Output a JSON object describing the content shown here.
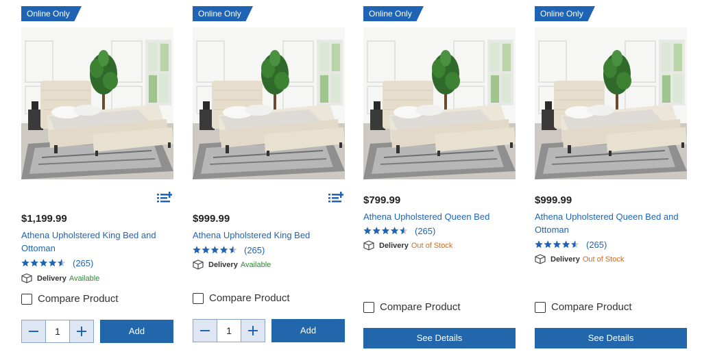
{
  "colors": {
    "accent": "#1f64b4",
    "button": "#2266ab",
    "available": "#2b8a2b",
    "out_of_stock": "#d2691e"
  },
  "products": [
    {
      "badge": "Online Only",
      "price": "$1,199.99",
      "title": "Athena Upholstered King Bed and Ottoman",
      "rating": 4.5,
      "review_count": "(265)",
      "delivery_label": "Delivery",
      "delivery_status": "Available",
      "compare_label": "Compare Product",
      "quantity": "1",
      "add_label": "Add",
      "icon": "add-to-list-icon"
    },
    {
      "badge": "Online Only",
      "price": "$999.99",
      "title": "Athena Upholstered King Bed",
      "rating": 4.5,
      "review_count": "(265)",
      "delivery_label": "Delivery",
      "delivery_status": "Available",
      "compare_label": "Compare Product",
      "quantity": "1",
      "add_label": "Add",
      "icon": "add-to-list-icon"
    },
    {
      "badge": "Online Only",
      "price": "$799.99",
      "title": "Athena Upholstered Queen Bed",
      "rating": 4.5,
      "review_count": "(265)",
      "delivery_label": "Delivery",
      "delivery_status": "Out of Stock",
      "compare_label": "Compare Product",
      "details_label": "See Details"
    },
    {
      "badge": "Online Only",
      "price": "$999.99",
      "title": "Athena Upholstered Queen Bed and Ottoman",
      "rating": 4.5,
      "review_count": "(265)",
      "delivery_label": "Delivery",
      "delivery_status": "Out of Stock",
      "compare_label": "Compare Product",
      "details_label": "See Details"
    }
  ]
}
